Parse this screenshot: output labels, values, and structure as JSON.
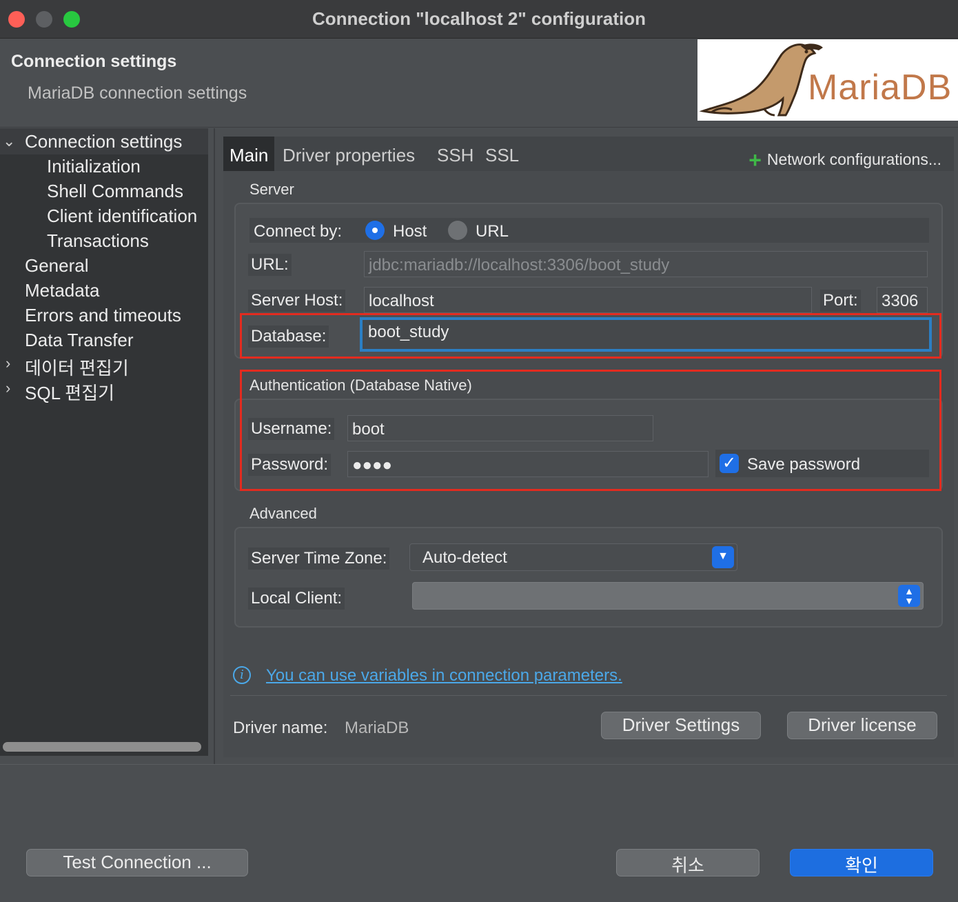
{
  "window": {
    "title": "Connection \"localhost 2\" configuration"
  },
  "header": {
    "title": "Connection settings",
    "subtitle": "MariaDB connection settings",
    "logo_text": "MariaDB"
  },
  "sidebar": {
    "items": [
      {
        "label": "Connection settings",
        "expanded": true
      },
      {
        "label": "Initialization"
      },
      {
        "label": "Shell Commands"
      },
      {
        "label": "Client identification"
      },
      {
        "label": "Transactions"
      },
      {
        "label": "General"
      },
      {
        "label": "Metadata"
      },
      {
        "label": "Errors and timeouts"
      },
      {
        "label": "Data Transfer"
      },
      {
        "label": "데이터 편집기",
        "collapsed": true
      },
      {
        "label": "SQL 편집기",
        "collapsed": true
      }
    ]
  },
  "tabs": {
    "items": [
      "Main",
      "Driver properties",
      "SSH",
      "SSL"
    ],
    "active": "Main",
    "network_config": "Network configurations..."
  },
  "server": {
    "section_label": "Server",
    "connect_by_label": "Connect by:",
    "host_option": "Host",
    "url_option": "URL",
    "connect_by_selected": "Host",
    "url_label": "URL:",
    "url_value": "jdbc:mariadb://localhost:3306/boot_study",
    "host_label": "Server Host:",
    "host_value": "localhost",
    "port_label": "Port:",
    "port_value": "3306",
    "database_label": "Database:",
    "database_value": "boot_study"
  },
  "auth": {
    "section_label": "Authentication (Database Native)",
    "username_label": "Username:",
    "username_value": "boot",
    "password_label": "Password:",
    "password_value": "●●●●",
    "save_password_label": "Save password",
    "save_password_checked": true
  },
  "advanced": {
    "section_label": "Advanced",
    "timezone_label": "Server Time Zone:",
    "timezone_value": "Auto-detect",
    "local_client_label": "Local Client:",
    "local_client_value": ""
  },
  "info": {
    "link_text": "You can use variables in connection parameters."
  },
  "driver": {
    "name_label": "Driver name:",
    "name_value": "MariaDB",
    "settings_button": "Driver Settings",
    "license_button": "Driver license"
  },
  "footer": {
    "test_button": "Test Connection ...",
    "cancel_button": "취소",
    "ok_button": "확인"
  },
  "colors": {
    "accent": "#1f6fe6",
    "highlight_box": "#e32b1f",
    "link": "#4ba8e8",
    "focus_ring": "#2b7fc4"
  }
}
